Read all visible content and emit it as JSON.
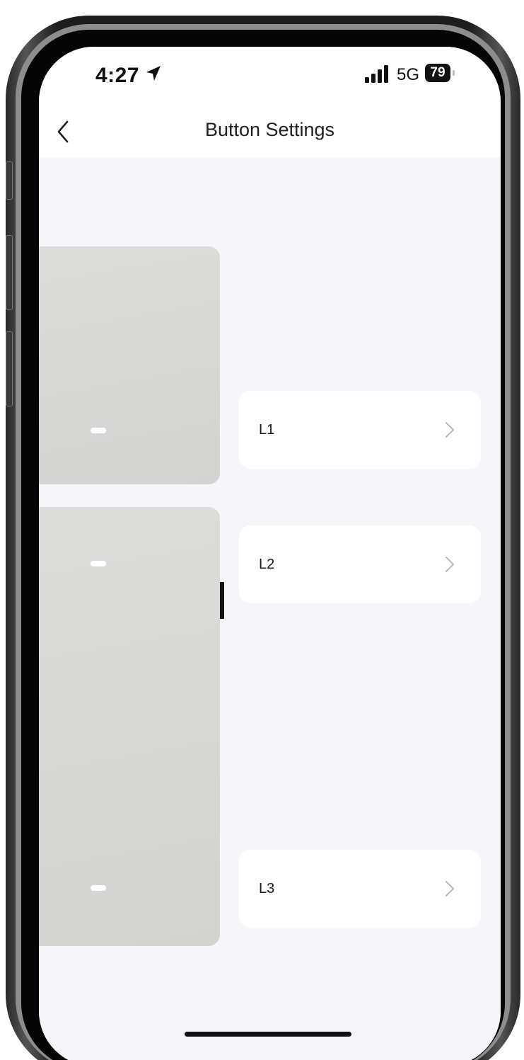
{
  "status_bar": {
    "time": "4:27",
    "network": "5G",
    "battery": "79",
    "icons": [
      "location-arrow-icon",
      "cellular-signal-icon",
      "battery-icon"
    ]
  },
  "header": {
    "title": "Button Settings",
    "back_icon": "chevron-left-icon"
  },
  "buttons": [
    {
      "label": "L1",
      "icon": "chevron-right-icon"
    },
    {
      "label": "L2",
      "icon": "chevron-right-icon"
    },
    {
      "label": "L3",
      "icon": "chevron-right-icon"
    }
  ],
  "colors": {
    "background": "#f6f6fa",
    "card": "#ffffff",
    "switch_panel": "#d8d8d6",
    "switch_gap": "#141414",
    "indicator_led": "#ffffff",
    "chevron": "#b8b8bc"
  }
}
